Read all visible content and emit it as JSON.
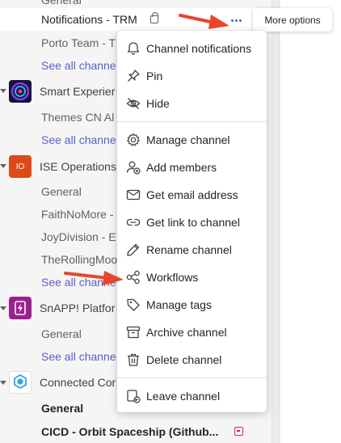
{
  "tree": {
    "top_partial": "General",
    "selected_channel": "Notifications - TRM",
    "rows": [
      {
        "text": "Porto Team - T"
      },
      {
        "text": "See all channe"
      },
      {
        "text": "Smart Experier"
      },
      {
        "text": "Themes CN Al"
      },
      {
        "text": "See all channe"
      },
      {
        "text": "ISE Operations"
      },
      {
        "text": "General"
      },
      {
        "text": "FaithNoMore -"
      },
      {
        "text": "JoyDivision - E"
      },
      {
        "text": "TheRollingMoo"
      },
      {
        "text": "See all channe"
      },
      {
        "text": "SnAPP! Platfor"
      },
      {
        "text": "General"
      },
      {
        "text": "See all channe"
      },
      {
        "text": "Connected Cor"
      },
      {
        "text": "General"
      },
      {
        "text": "CICD - Orbit Spaceship (Github..."
      }
    ],
    "ise_avatar_text": "IO"
  },
  "tooltip": "More options",
  "menu": {
    "items": [
      {
        "label": "Channel notifications",
        "icon": "bell-icon"
      },
      {
        "label": "Pin",
        "icon": "pin-icon"
      },
      {
        "label": "Hide",
        "icon": "eye-off-icon"
      },
      {
        "label": "Manage channel",
        "icon": "gear-icon"
      },
      {
        "label": "Add members",
        "icon": "add-person-icon"
      },
      {
        "label": "Get email address",
        "icon": "mail-icon"
      },
      {
        "label": "Get link to channel",
        "icon": "link-icon"
      },
      {
        "label": "Rename channel",
        "icon": "pencil-icon"
      },
      {
        "label": "Workflows",
        "icon": "workflow-icon"
      },
      {
        "label": "Manage tags",
        "icon": "tag-icon"
      },
      {
        "label": "Archive channel",
        "icon": "archive-icon"
      },
      {
        "label": "Delete channel",
        "icon": "trash-icon"
      },
      {
        "label": "Leave channel",
        "icon": "leave-icon"
      }
    ]
  },
  "colors": {
    "accent": "#5b5fc7",
    "annotation_arrow": "#e8452c",
    "ise_avatar": "#dc4a1a",
    "snapp_avatar": "#9b1f8f"
  }
}
